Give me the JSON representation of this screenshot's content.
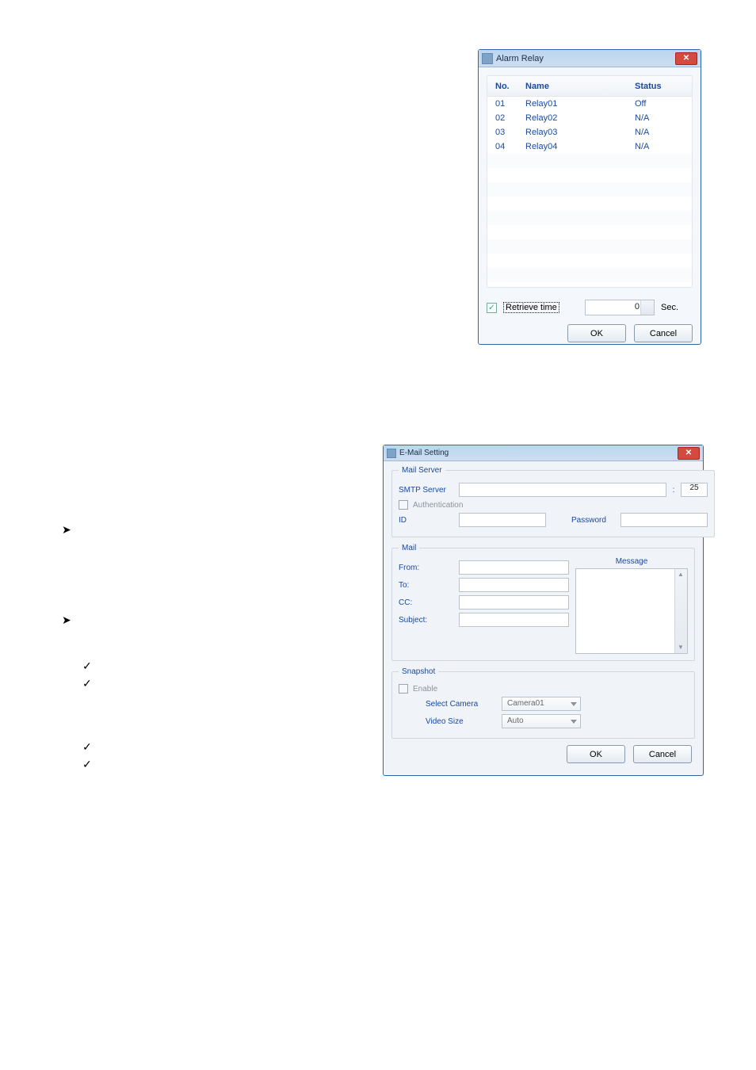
{
  "glyphs": {
    "arrow": "➤",
    "check": "✓"
  },
  "alarmRelay": {
    "title": "Alarm Relay",
    "columns": {
      "no": "No.",
      "name": "Name",
      "status": "Status"
    },
    "rows": [
      {
        "no": "01",
        "name": "Relay01",
        "status": "Off"
      },
      {
        "no": "02",
        "name": "Relay02",
        "status": "N/A"
      },
      {
        "no": "03",
        "name": "Relay03",
        "status": "N/A"
      },
      {
        "no": "04",
        "name": "Relay04",
        "status": "N/A"
      }
    ],
    "retrieve": {
      "checked": true,
      "label": "Retrieve time",
      "value": "0",
      "unit": "Sec."
    },
    "ok": "OK",
    "cancel": "Cancel"
  },
  "email": {
    "title": "E-Mail Setting",
    "mailServer": {
      "legend": "Mail Server",
      "smtpLabel": "SMTP Server",
      "smtpValue": "",
      "port": "25",
      "auth": {
        "label": "Authentication",
        "checked": false
      },
      "idLabel": "ID",
      "idValue": "",
      "pwLabel": "Password",
      "pwValue": ""
    },
    "mail": {
      "legend": "Mail",
      "messageHeader": "Message",
      "from": "From:",
      "to": "To:",
      "cc": "CC:",
      "subject": "Subject:"
    },
    "snapshot": {
      "legend": "Snapshot",
      "enable": {
        "label": "Enable",
        "checked": false
      },
      "selectCamera": {
        "label": "Select Camera",
        "value": "Camera01"
      },
      "videoSize": {
        "label": "Video Size",
        "value": "Auto"
      }
    },
    "ok": "OK",
    "cancel": "Cancel"
  }
}
